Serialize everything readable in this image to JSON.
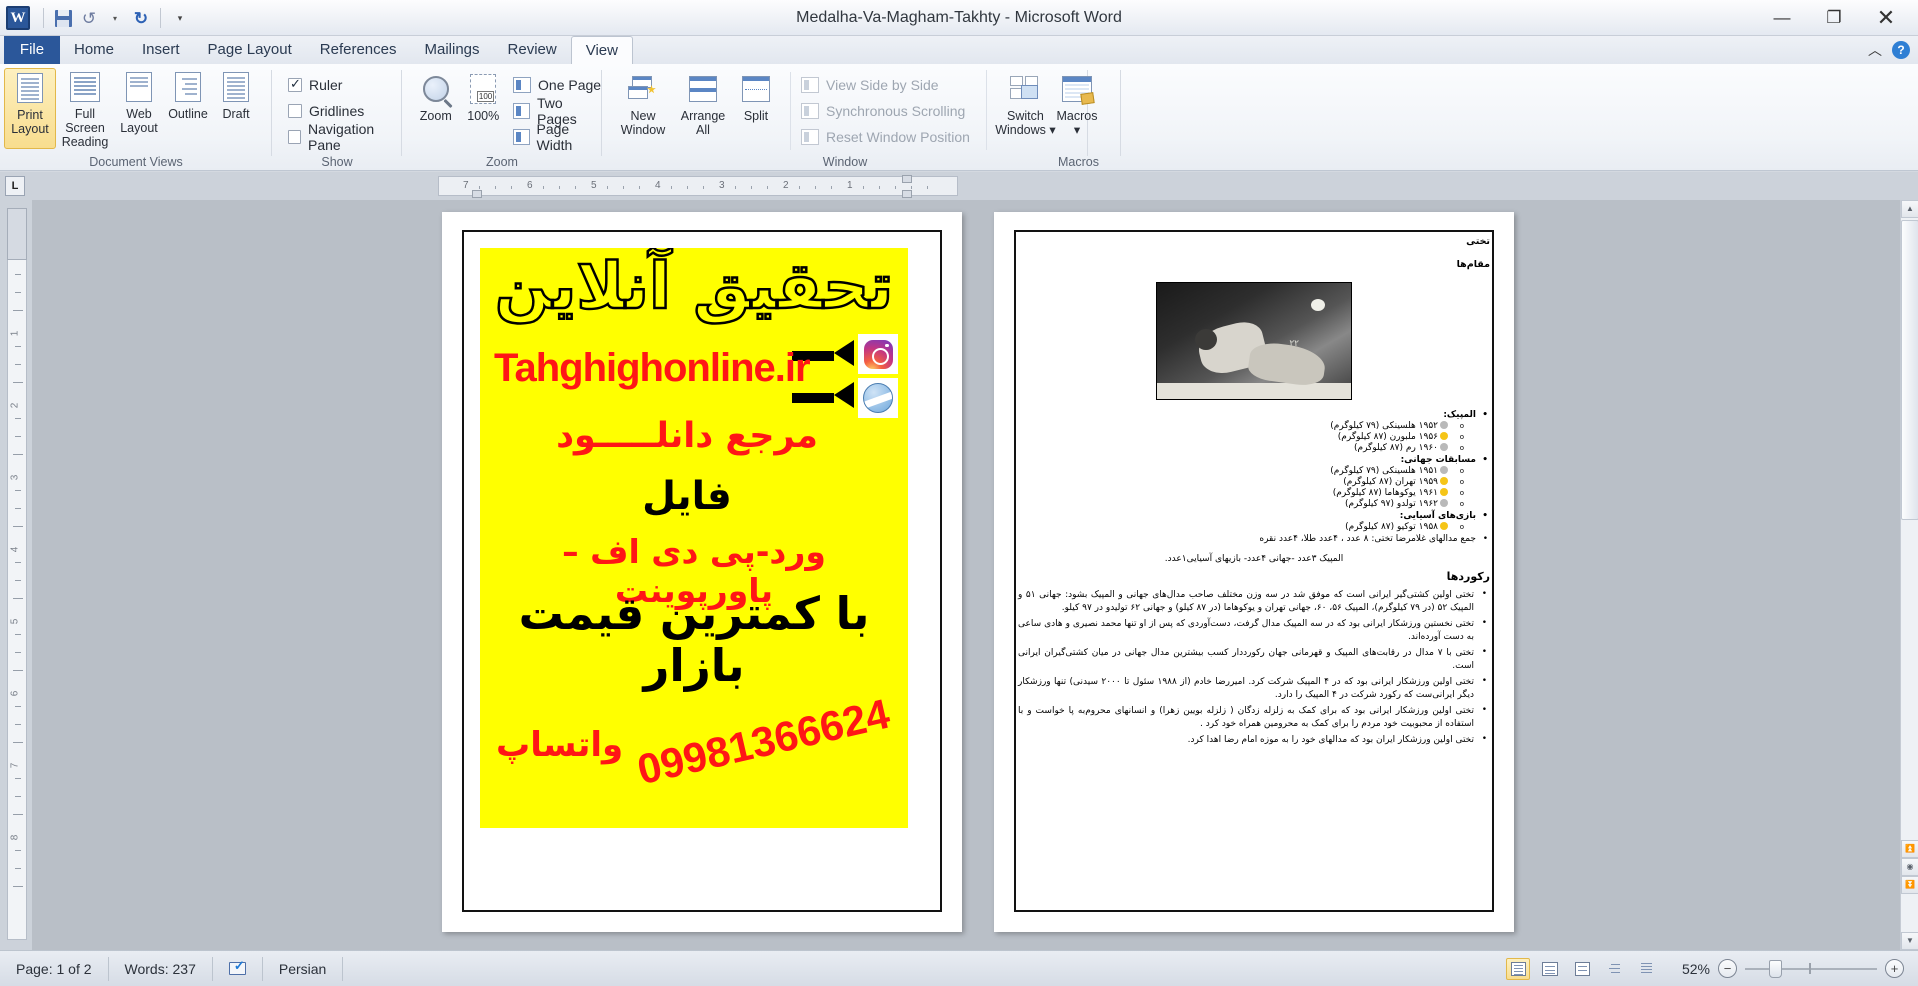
{
  "window": {
    "title": "Medalha-Va-Magham-Takhty  -  Microsoft Word",
    "minimize": "—",
    "restore": "❐",
    "close": "✕"
  },
  "quick_access": {
    "app_logo": "W",
    "save": "save-icon",
    "undo": "↺",
    "undo_drop": "▾",
    "redo": "↻",
    "customize": "▾"
  },
  "tabs": [
    {
      "label": "File",
      "active": false,
      "file": true
    },
    {
      "label": "Home",
      "active": false
    },
    {
      "label": "Insert",
      "active": false
    },
    {
      "label": "Page Layout",
      "active": false
    },
    {
      "label": "References",
      "active": false
    },
    {
      "label": "Mailings",
      "active": false
    },
    {
      "label": "Review",
      "active": false
    },
    {
      "label": "View",
      "active": true
    }
  ],
  "tab_right": {
    "minimize_ribbon": "︿",
    "help": "?"
  },
  "ribbon": {
    "groups": [
      {
        "name": "Document Views",
        "label": "Document Views",
        "buttons": [
          {
            "label": "Print Layout",
            "selected": true
          },
          {
            "label": "Full Screen Reading",
            "selected": false
          },
          {
            "label": "Web Layout",
            "selected": false
          },
          {
            "label": "Outline",
            "selected": false
          },
          {
            "label": "Draft",
            "selected": false
          }
        ]
      },
      {
        "name": "Show",
        "label": "Show",
        "checks": [
          {
            "label": "Ruler",
            "checked": true
          },
          {
            "label": "Gridlines",
            "checked": false
          },
          {
            "label": "Navigation Pane",
            "checked": false
          }
        ]
      },
      {
        "name": "Zoom",
        "label": "Zoom",
        "buttons": [
          {
            "label": "Zoom"
          },
          {
            "label": "100%"
          }
        ],
        "small": [
          {
            "label": "One Page",
            "disabled": false
          },
          {
            "label": "Two Pages",
            "disabled": false
          },
          {
            "label": "Page Width",
            "disabled": false
          }
        ]
      },
      {
        "name": "Window",
        "label": "Window",
        "buttons": [
          {
            "label": "New Window"
          },
          {
            "label": "Arrange All"
          },
          {
            "label": "Split"
          }
        ],
        "small": [
          {
            "label": "View Side by Side",
            "disabled": true
          },
          {
            "label": "Synchronous Scrolling",
            "disabled": true
          },
          {
            "label": "Reset Window Position",
            "disabled": true
          }
        ],
        "switch": {
          "label": "Switch Windows",
          "drop": "▾"
        }
      },
      {
        "name": "Macros",
        "label": "Macros",
        "buttons": [
          {
            "label": "Macros",
            "drop": "▾"
          }
        ]
      }
    ]
  },
  "ruler": {
    "tab_selector": "L",
    "h_marks": [
      "7",
      "6",
      "5",
      "4",
      "3",
      "2",
      "1"
    ],
    "v_marks": [
      "1",
      "2",
      "3",
      "4",
      "5",
      "6",
      "7",
      "8"
    ]
  },
  "document": {
    "page1": {
      "ad": {
        "headline": "تحقیق آنلاین",
        "site": "Tahghighonline.ir",
        "line3": "مرجع دانلـــــود",
        "line4": "فایل",
        "line5": "ورد-پی دی اف – پاورپوینت",
        "line6": "با کمترین قیمت بازار",
        "whatsapp_label": "واتساپ",
        "phone": "09981366624",
        "instagram_icon": "instagram-icon",
        "web_icon": "globe-icon"
      }
    },
    "page2": {
      "heading1": "تختی",
      "heading2": "مقام‌ها",
      "photo_alt": "wrestling-photo",
      "sections": [
        {
          "title": "المپیک:",
          "items": [
            {
              "text": "۱۹۵۲ هلسینکی (۷۹ کیلوگرم)",
              "medal": "#b9b9b9"
            },
            {
              "text": "۱۹۵۶ ملبورن (۸۷ کیلوگرم)",
              "medal": "#f5c518"
            },
            {
              "text": "۱۹۶۰ رم (۸۷ کیلوگرم)",
              "medal": "#b9b9b9"
            }
          ]
        },
        {
          "title": "مسابقات جهانی:",
          "items": [
            {
              "text": "۱۹۵۱ هلسینکی (۷۹ کیلوگرم)",
              "medal": "#b9b9b9"
            },
            {
              "text": "۱۹۵۹ تهران (۸۷ کیلوگرم)",
              "medal": "#f5c518"
            },
            {
              "text": "۱۹۶۱ یوکوهاما (۸۷ کیلوگرم)",
              "medal": "#f5c518"
            },
            {
              "text": "۱۹۶۲ تولدو (۹۷ کیلوگرم)",
              "medal": "#b9b9b9"
            }
          ]
        },
        {
          "title": "بازی‌های آسیایی:",
          "items": [
            {
              "text": "۱۹۵۸ توکیو (۸۷ کیلوگرم)",
              "medal": "#f5c518"
            }
          ]
        }
      ],
      "summary_bullet": "جمع مدالهای غلامرضا تختی: ۸ عدد ، ۴عدد طلا، ۴عدد نقره",
      "summary_line": "المپیک ۳عدد -جهانی ۴عدد- بازیهای آسیایی۱عدد.",
      "records_heading": "رکوردها",
      "records": [
        "تختی اولین کشتی‌گیر ایرانی است که موفق شد در سه وزن مختلف صاحب مدال‌های جهانی و المپیک بشود: جهانی ۵۱ و المپیک ۵۲ (در ۷۹ کیلوگرم)، المپیک ۵۶، ۶۰، جهانی تهران و یوکوهاما (در ۸۷ کیلو) و جهانی ۶۲ تولیدو در ۹۷ کیلو.",
        "تختی نخستین ورزشکار ایرانی بود که در سه المپیک مدال گرفت، دست‌آوردی که پس از او تنها محمد نصیری و هادی ساعی به دست آورده‌اند.",
        "تختی با ۷ مدال در رقابت‌های المپیک و قهرمانی جهان رکورددار کسب بیشترین مدال جهانی در میان کشتی‌گیران ایرانی است.",
        "تختی اولین ورزشکار ایرانی بود که در ۴ المپیک شرکت کرد. امیررضا خادم (از ۱۹۸۸ سئول تا ۲۰۰۰ سیدنی) تنها ورزشکار دیگر ایرانی‌ست که رکورد شرکت در ۴ المپیک را دارد.",
        "تختی اولین ورزشکار ایرانی بود که برای کمک به زلزله زدگان ( زلزله بویین زهرا) و انسانهای محروم‌به پا خواست و با استفاده از محبوبیت خود مردم را برای کمک به محرومین همراه خود کرد .",
        "تختی اولین ورزشکار ایران بود که مدالهای خود را به موزه امام رضا اهدا کرد."
      ]
    }
  },
  "status_bar": {
    "page": "Page: 1 of 2",
    "words": "Words: 237",
    "proof_icon": "spell-check-icon",
    "language": "Persian",
    "view_buttons": [
      {
        "name": "print-layout-view",
        "selected": true
      },
      {
        "name": "full-screen-reading-view",
        "selected": false
      },
      {
        "name": "web-layout-view",
        "selected": false
      },
      {
        "name": "outline-view",
        "selected": false
      },
      {
        "name": "draft-view",
        "selected": false
      }
    ],
    "zoom_level": "52%",
    "zoom_out": "−",
    "zoom_in": "+"
  }
}
